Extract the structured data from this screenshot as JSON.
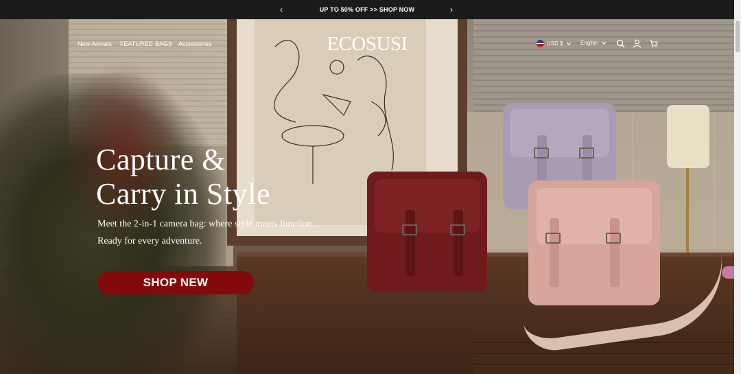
{
  "announcement": {
    "text": "UP TO 50% OFF >> SHOP NOW",
    "prev": "‹",
    "next": "›"
  },
  "nav": {
    "links": [
      "New Arrivals",
      "FEATURED",
      "BAGS",
      "Accessories"
    ],
    "logo": "ECOSUSI",
    "currency": "USD $",
    "language": "English",
    "icons": [
      "search-icon",
      "user-icon",
      "cart-icon"
    ]
  },
  "hero": {
    "headline_line1": "Capture &",
    "headline_line2": "Carry in Style",
    "subtitle_line1": "Meet the 2-in-1 camera bag: where style meets function.",
    "subtitle_line2": "Ready for every adventure.",
    "cta": "SHOP NEW"
  },
  "colors": {
    "cta": "#830a0a",
    "announcement_bg": "#1b1b1b",
    "text": "#ffffff"
  }
}
